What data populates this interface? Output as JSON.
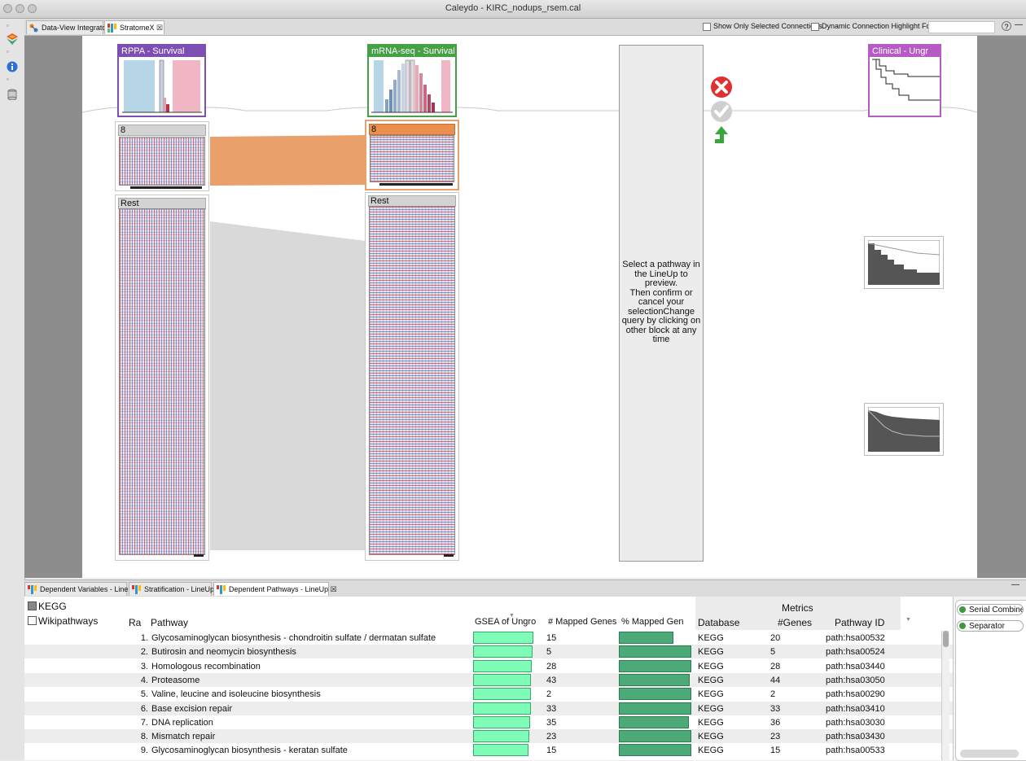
{
  "window": {
    "title": "Caleydo - KIRC_nodups_rsem.cal"
  },
  "top_tabs": [
    {
      "label": "Data-View Integrator"
    },
    {
      "label": "StratomeX",
      "close": "☒"
    }
  ],
  "toolbar": {
    "show_selected": "Show Only Selected Connections",
    "dynamic_highlight": "Dynamic Connection Highlight Focus",
    "help": "?"
  },
  "columns": [
    {
      "title": "RPPA - Survival",
      "color": "#7e4fb3",
      "groups": [
        {
          "label": "8"
        },
        {
          "label": "Rest"
        }
      ]
    },
    {
      "title": "mRNA-seq - Survival",
      "color": "#46a046",
      "groups": [
        {
          "label": "8"
        },
        {
          "label": "Rest"
        }
      ]
    },
    {
      "title": "Clinical - Ungr",
      "color": "#b65bc4"
    }
  ],
  "preview": {
    "lines": [
      "Select a pathway in",
      "the LineUp to",
      "preview.",
      "Then confirm or",
      "cancel your",
      "selectionChange",
      "query by clicking on",
      "other block at any",
      "time"
    ]
  },
  "colors": {
    "selection": "#e9a06a",
    "cancel": "#e03030",
    "confirm": "#c8c8c8",
    "upgrade": "#3aa63a"
  },
  "bottom_tabs": [
    {
      "label": "Dependent Variables - LineUp"
    },
    {
      "label": "Stratification - LineUp"
    },
    {
      "label": "Dependent Pathways - LineUp",
      "close": "☒"
    }
  ],
  "filters": [
    {
      "label": "KEGG"
    },
    {
      "label": "Wikipathways"
    }
  ],
  "table": {
    "headers": {
      "rank": "Ra",
      "pathway": "Pathway",
      "gsea": "GSEA of Ungro",
      "mapped": "# Mapped Genes",
      "pct": "% Mapped Gen",
      "metrics": "Metrics",
      "database": "Database",
      "genes": "#Genes",
      "pid": "Pathway ID"
    },
    "rows": [
      {
        "rank": "1.",
        "pathway": "Glycosaminoglycan biosynthesis - chondroitin sulfate / dermatan sulfate",
        "gsea": 0.98,
        "mapped": "15",
        "pct": 0.75,
        "database": "KEGG",
        "genes": "20",
        "pid": "path:hsa00532"
      },
      {
        "rank": "2.",
        "pathway": "Butirosin and neomycin biosynthesis",
        "gsea": 0.97,
        "mapped": "5",
        "pct": 1.0,
        "database": "KEGG",
        "genes": "5",
        "pid": "path:hsa00524"
      },
      {
        "rank": "3.",
        "pathway": "Homologous recombination",
        "gsea": 0.96,
        "mapped": "28",
        "pct": 1.0,
        "database": "KEGG",
        "genes": "28",
        "pid": "path:hsa03440"
      },
      {
        "rank": "4.",
        "pathway": "Proteasome",
        "gsea": 0.95,
        "mapped": "43",
        "pct": 0.98,
        "database": "KEGG",
        "genes": "44",
        "pid": "path:hsa03050"
      },
      {
        "rank": "5.",
        "pathway": "Valine, leucine and isoleucine biosynthesis",
        "gsea": 0.94,
        "mapped": "2",
        "pct": 1.0,
        "database": "KEGG",
        "genes": "2",
        "pid": "path:hsa00290"
      },
      {
        "rank": "6.",
        "pathway": "Base excision repair",
        "gsea": 0.94,
        "mapped": "33",
        "pct": 1.0,
        "database": "KEGG",
        "genes": "33",
        "pid": "path:hsa03410"
      },
      {
        "rank": "7.",
        "pathway": "DNA replication",
        "gsea": 0.93,
        "mapped": "35",
        "pct": 0.97,
        "database": "KEGG",
        "genes": "36",
        "pid": "path:hsa03030"
      },
      {
        "rank": "8.",
        "pathway": "Mismatch repair",
        "gsea": 0.92,
        "mapped": "23",
        "pct": 1.0,
        "database": "KEGG",
        "genes": "23",
        "pid": "path:hsa03430"
      },
      {
        "rank": "9.",
        "pathway": "Glycosaminoglycan biosynthesis - keratan sulfate",
        "gsea": 0.91,
        "mapped": "15",
        "pct": 1.0,
        "database": "KEGG",
        "genes": "15",
        "pid": "path:hsa00533"
      }
    ]
  },
  "combiner": [
    {
      "label": "Serial Combiner"
    },
    {
      "label": "Separator"
    }
  ]
}
